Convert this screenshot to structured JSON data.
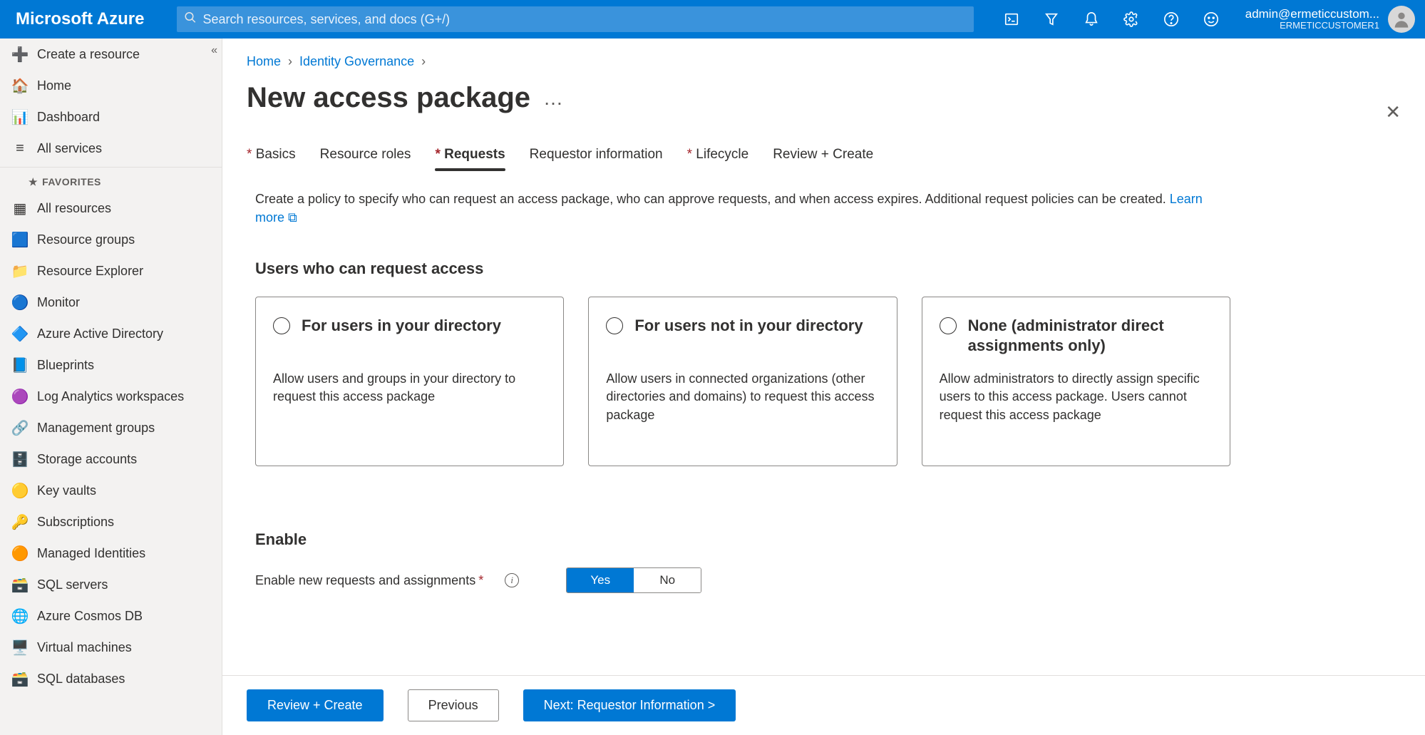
{
  "topbar": {
    "brand": "Microsoft Azure",
    "search_placeholder": "Search resources, services, and docs (G+/)",
    "account_email": "admin@ermeticcustom...",
    "account_tenant": "ERMETICCUSTOMER1"
  },
  "sidebar": {
    "primary": [
      {
        "icon": "plus",
        "label": "Create a resource"
      },
      {
        "icon": "home",
        "label": "Home"
      },
      {
        "icon": "dashboard",
        "label": "Dashboard"
      },
      {
        "icon": "list",
        "label": "All services"
      }
    ],
    "favorites_header": "FAVORITES",
    "favorites": [
      {
        "icon": "grid",
        "label": "All resources"
      },
      {
        "icon": "rg",
        "label": "Resource groups"
      },
      {
        "icon": "folder",
        "label": "Resource Explorer"
      },
      {
        "icon": "monitor",
        "label": "Monitor"
      },
      {
        "icon": "aad",
        "label": "Azure Active Directory"
      },
      {
        "icon": "blueprints",
        "label": "Blueprints"
      },
      {
        "icon": "log",
        "label": "Log Analytics workspaces"
      },
      {
        "icon": "mgmt",
        "label": "Management groups"
      },
      {
        "icon": "storage",
        "label": "Storage accounts"
      },
      {
        "icon": "keyvault",
        "label": "Key vaults"
      },
      {
        "icon": "key",
        "label": "Subscriptions"
      },
      {
        "icon": "managed",
        "label": "Managed Identities"
      },
      {
        "icon": "sql",
        "label": "SQL servers"
      },
      {
        "icon": "cosmos",
        "label": "Azure Cosmos DB"
      },
      {
        "icon": "vm",
        "label": "Virtual machines"
      },
      {
        "icon": "sqldb",
        "label": "SQL databases"
      }
    ]
  },
  "breadcrumbs": {
    "home": "Home",
    "ig": "Identity Governance"
  },
  "page": {
    "title": "New access package",
    "intro": "Create a policy to specify who can request an access package, who can approve requests, and when access expires. Additional request policies can be created. ",
    "learn_more": "Learn more"
  },
  "tabs": [
    {
      "label": "Basics",
      "required": true,
      "active": false
    },
    {
      "label": "Resource roles",
      "required": false,
      "active": false
    },
    {
      "label": "Requests",
      "required": true,
      "active": true
    },
    {
      "label": "Requestor information",
      "required": false,
      "active": false
    },
    {
      "label": "Lifecycle",
      "required": true,
      "active": false
    },
    {
      "label": "Review + Create",
      "required": false,
      "active": false
    }
  ],
  "section1_title": "Users who can request access",
  "cards": [
    {
      "title": "For users in your directory",
      "desc": "Allow users and groups in your directory to request this access package"
    },
    {
      "title": "For users not in your directory",
      "desc": "Allow users in connected organizations (other directories and domains) to request this access package"
    },
    {
      "title": "None (administrator direct assignments only)",
      "desc": "Allow administrators to directly assign specific users to this access package. Users cannot request this access package"
    }
  ],
  "enable": {
    "heading": "Enable",
    "label": "Enable new requests and assignments",
    "yes": "Yes",
    "no": "No"
  },
  "footer": {
    "review": "Review + Create",
    "previous": "Previous",
    "next": "Next: Requestor Information >"
  }
}
